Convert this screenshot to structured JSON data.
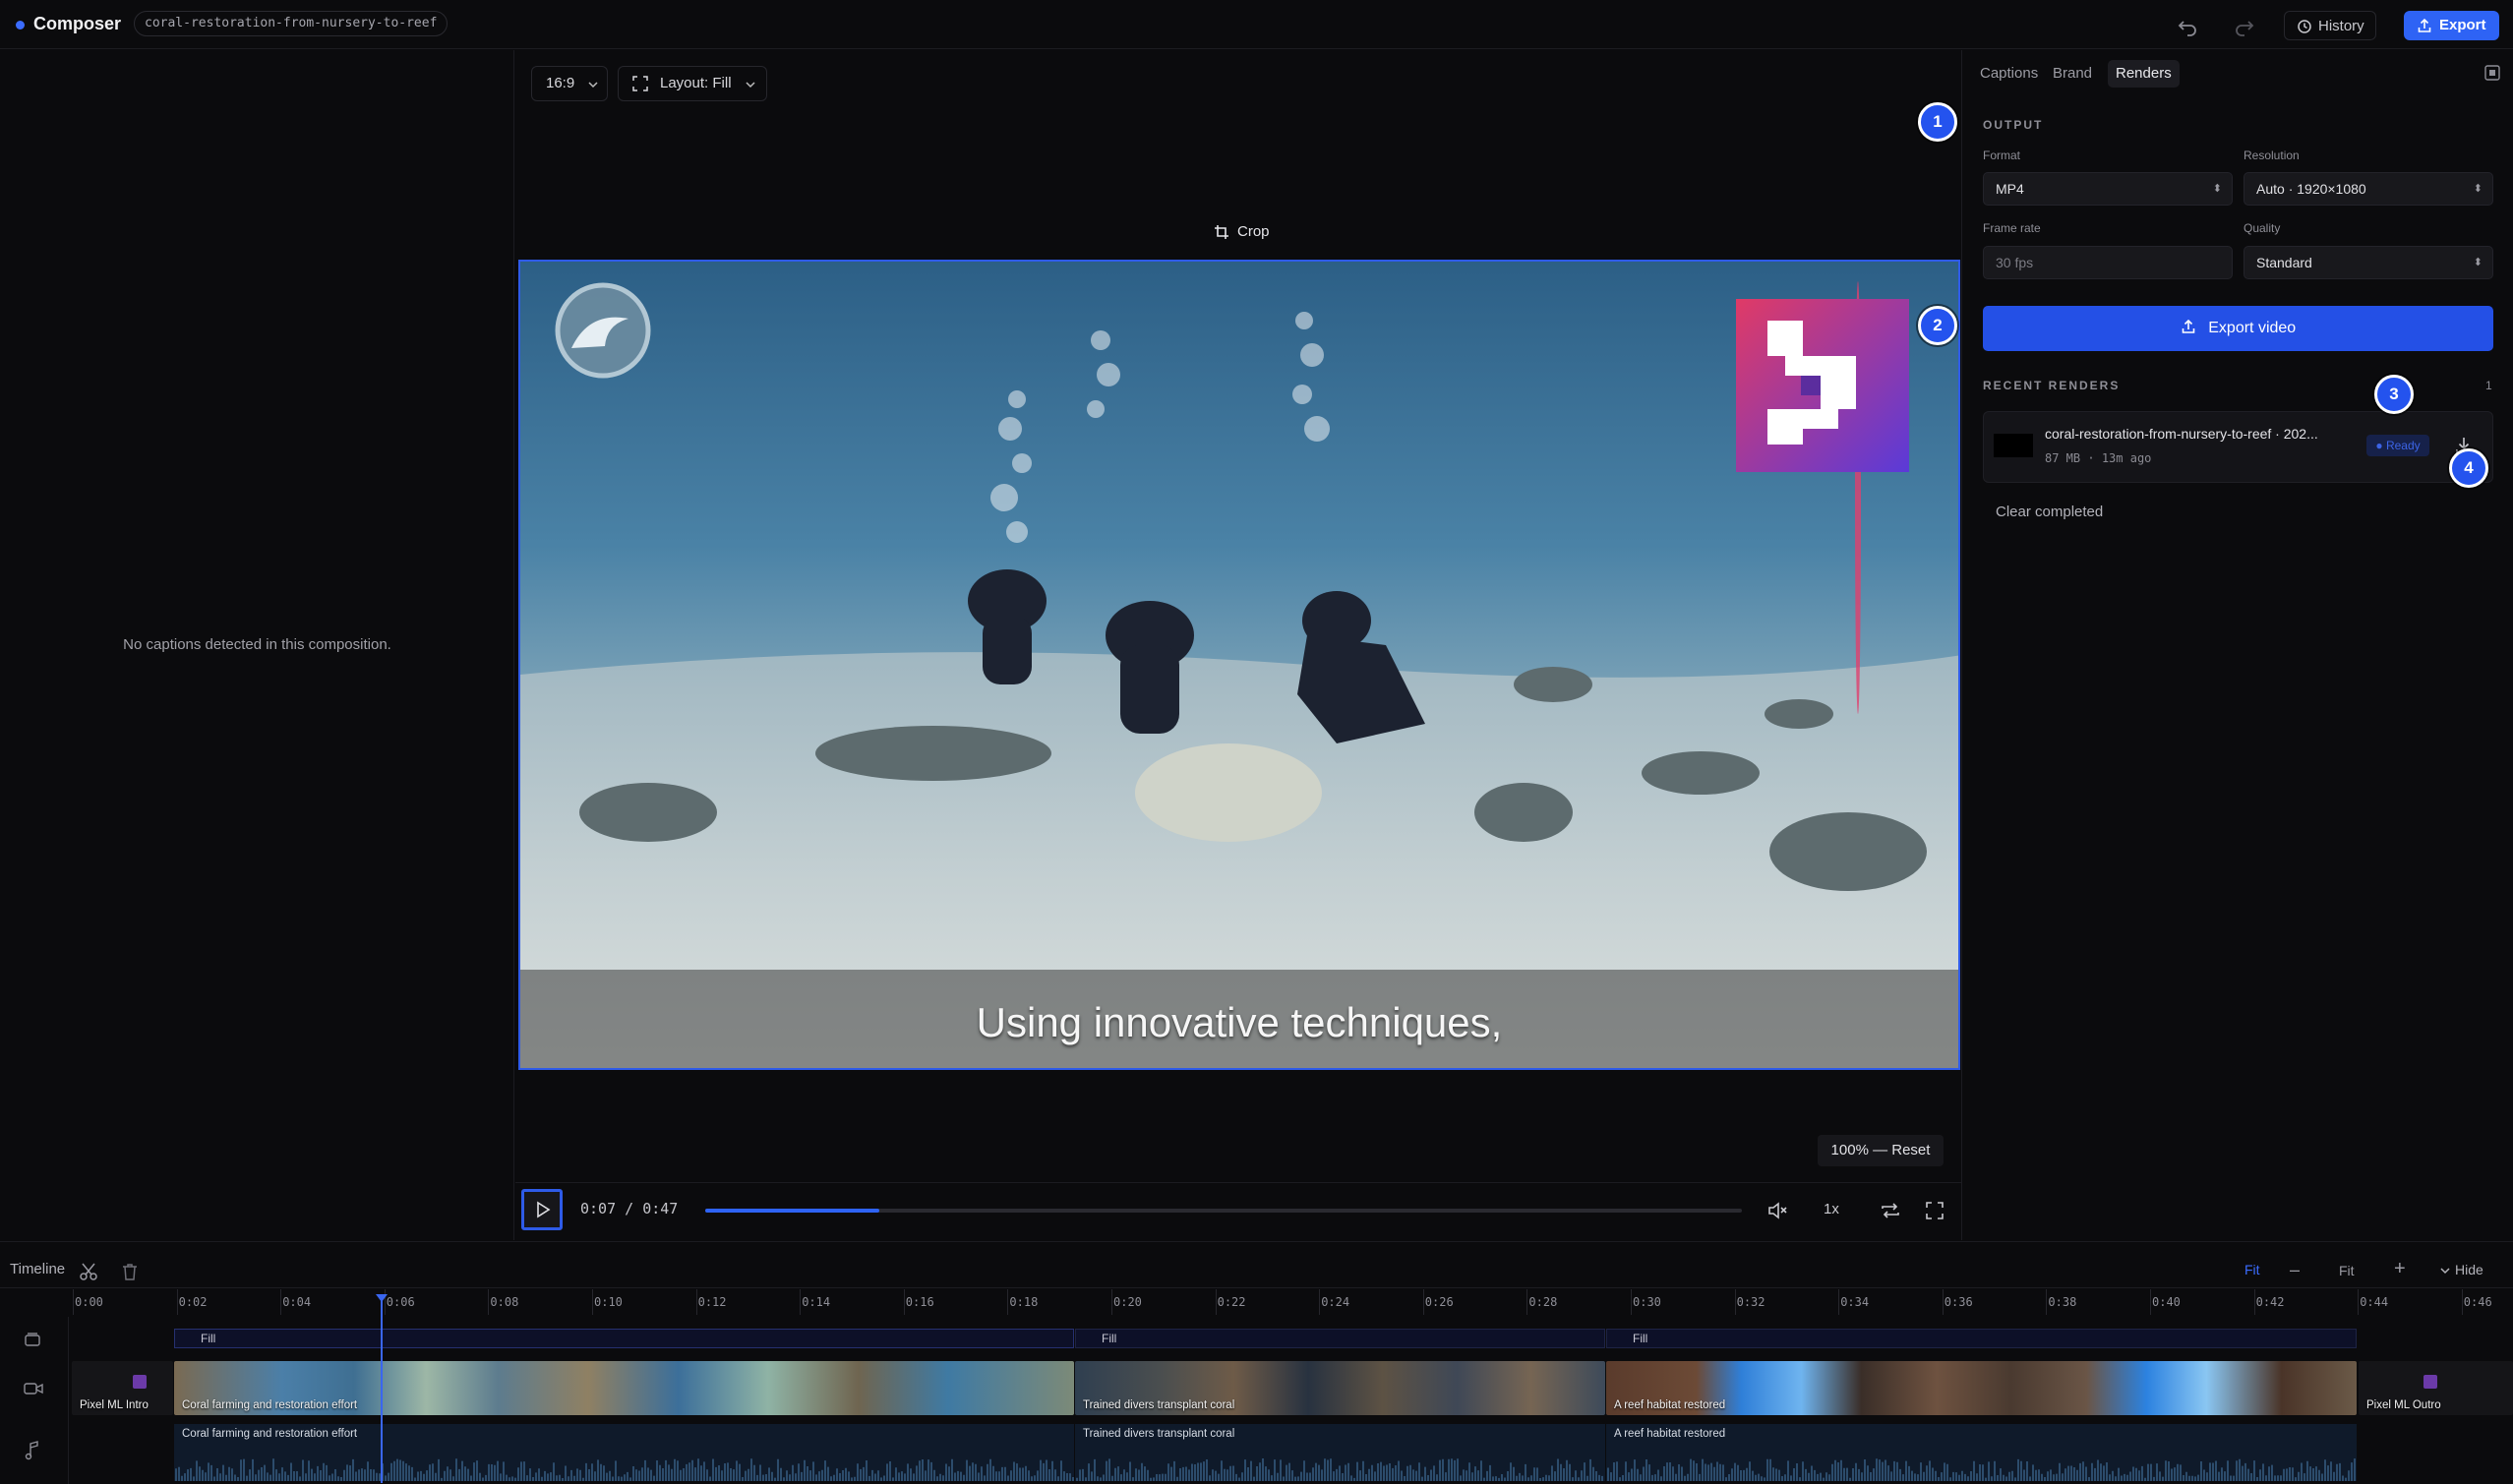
{
  "topbar": {
    "app_title": "Composer",
    "project_slug": "coral-restoration-from-nursery-to-reef",
    "history_label": "History",
    "export_label": "Export"
  },
  "left_panel": {
    "empty_message": "No captions detected in this composition."
  },
  "canvas": {
    "aspect_label": "16:9",
    "layout_label": "Layout: Fill",
    "crop_label": "Crop",
    "caption_text": "Using innovative techniques,",
    "zoom_label": "100% — Reset"
  },
  "player": {
    "current_time": "0:07",
    "separator": "/",
    "duration": "0:47",
    "progress_fraction": 0.168,
    "speed_label": "1x"
  },
  "right_panel": {
    "tabs": [
      {
        "label": "Captions"
      },
      {
        "label": "Brand"
      },
      {
        "label": "Renders"
      }
    ],
    "output": {
      "section_title": "OUTPUT",
      "format_label": "Format",
      "format_value": "MP4",
      "resolution_label": "Resolution",
      "resolution_value": "Auto · 1920×1080",
      "frame_rate_label": "Frame rate",
      "frame_rate_value": "30 fps",
      "quality_label": "Quality",
      "quality_value": "Standard",
      "export_video_label": "Export video"
    },
    "recent": {
      "section_title": "RECENT RENDERS",
      "count": "1",
      "item_name": "coral-restoration-from-nursery-to-reef · 202...",
      "item_size": "87 MB",
      "item_dot": "·",
      "item_age": "13m ago",
      "status": "● Ready",
      "clear_label": "Clear completed"
    }
  },
  "markers": [
    "1",
    "2",
    "3",
    "4"
  ],
  "timeline": {
    "title": "Timeline",
    "fit_active": "Fit",
    "fit_label": "Fit",
    "hide_label": "Hide",
    "ticks": [
      "0:00",
      "0:02",
      "0:04",
      "0:06",
      "0:08",
      "0:10",
      "0:12",
      "0:14",
      "0:16",
      "0:18",
      "0:20",
      "0:22",
      "0:24",
      "0:26",
      "0:28",
      "0:30",
      "0:32",
      "0:34",
      "0:36",
      "0:38",
      "0:40",
      "0:42",
      "0:44",
      "0:46"
    ],
    "fill_label": "Fill",
    "clips": {
      "intro": "Pixel ML Intro",
      "c1": "Coral farming and restoration effort",
      "c2": "Trained divers transplant coral",
      "c3": "A reef habitat restored",
      "outro": "Pixel ML Outro"
    }
  },
  "colors": {
    "accent": "#2e63f5",
    "selection": "#2f5be8",
    "playhead": "#3a66f0"
  }
}
